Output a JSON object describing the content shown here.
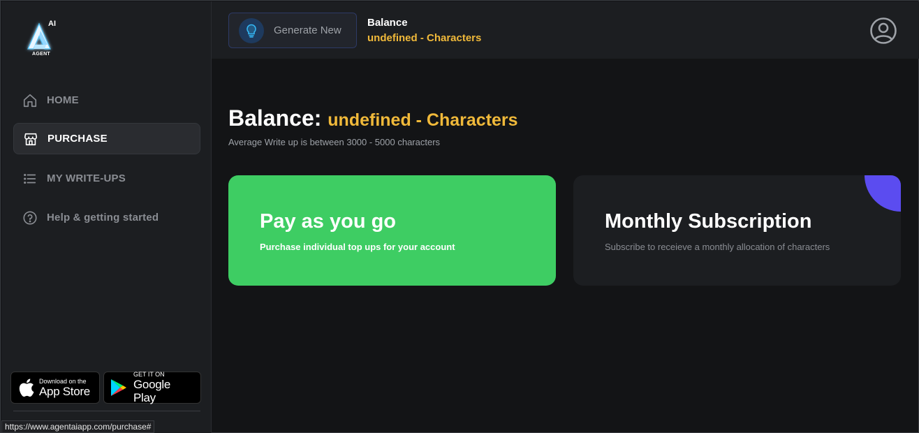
{
  "brand": {
    "logo_text": "AI",
    "logo_subtext": "AGENT"
  },
  "sidebar": {
    "items": [
      {
        "label": "HOME",
        "icon": "home-icon",
        "active": false
      },
      {
        "label": "PURCHASE",
        "icon": "store-icon",
        "active": true
      },
      {
        "label": "MY WRITE-UPS",
        "icon": "list-icon",
        "active": false
      },
      {
        "label": "Help & getting started",
        "icon": "help-circle-icon",
        "active": false
      }
    ],
    "app_store": {
      "small": "Download on the",
      "big": "App Store"
    },
    "google_play": {
      "small": "GET IT ON",
      "big": "Google Play"
    }
  },
  "header": {
    "generate_label": "Generate New",
    "balance_title": "Balance",
    "balance_value": "undefined - Characters"
  },
  "main": {
    "title_prefix": "Balance:",
    "title_value": "undefined - Characters",
    "subtitle": "Average Write up is between 3000 - 5000 characters",
    "cards": {
      "payg": {
        "title": "Pay as you go",
        "subtitle": "Purchase individual top ups for your account"
      },
      "subscription": {
        "title": "Monthly Subscription",
        "subtitle": "Subscribe to receieve a monthly allocation of characters"
      }
    }
  },
  "status_bar": {
    "url": "https://www.agentaiapp.com/purchase#"
  },
  "colors": {
    "accent_yellow": "#f0b93a",
    "green": "#3ecd63",
    "purple": "#5b4cf0",
    "background": "#131416",
    "panel": "#1c1e21"
  }
}
